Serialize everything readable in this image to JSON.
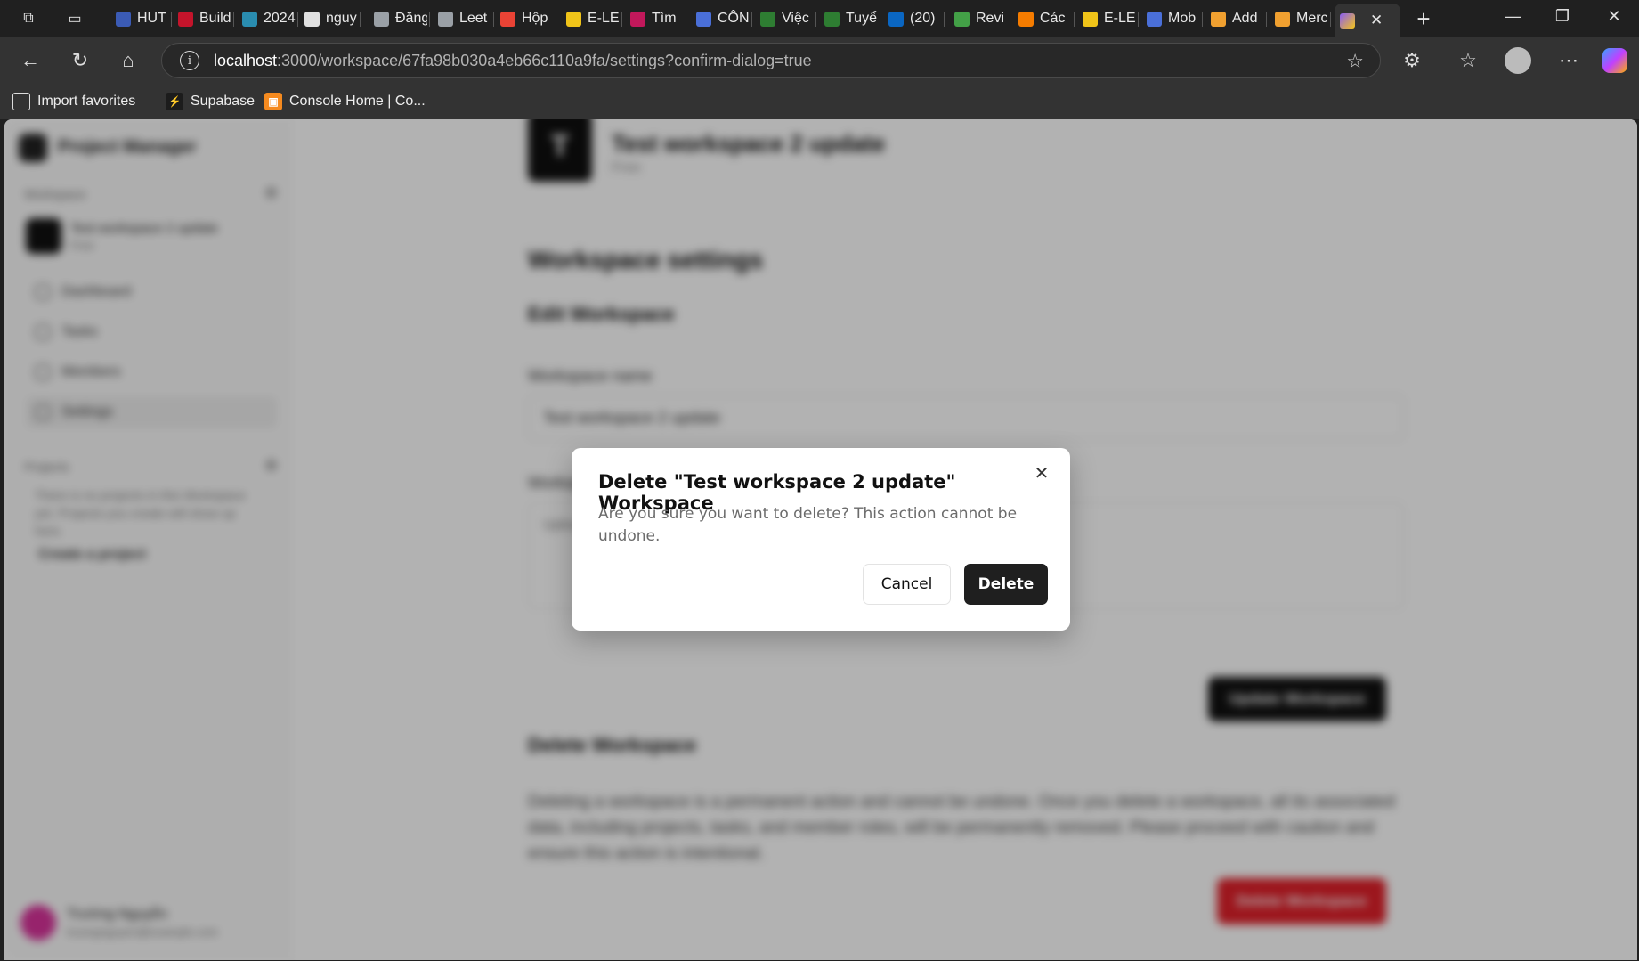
{
  "browser": {
    "tabs": [
      {
        "label": "HUT",
        "color": "#3b5bb5"
      },
      {
        "label": "Build",
        "color": "#c4142b"
      },
      {
        "label": "2024",
        "color": "#2a8db0"
      },
      {
        "label": "nguy",
        "color": "#e0e0e0"
      },
      {
        "label": "Đăng",
        "color": "#9aa0a6"
      },
      {
        "label": "Leet",
        "color": "#9aa0a6"
      },
      {
        "label": "Hộp",
        "color": "#ea4335"
      },
      {
        "label": "E-LE",
        "color": "#f0c419"
      },
      {
        "label": "Tìm",
        "color": "#c2185b"
      },
      {
        "label": "CÔN",
        "color": "#4a6fd8"
      },
      {
        "label": "Việc",
        "color": "#2e7d32"
      },
      {
        "label": "Tuyể",
        "color": "#2e7d32"
      },
      {
        "label": "(20)",
        "color": "#0a66c2"
      },
      {
        "label": "Revi",
        "color": "#43a047"
      },
      {
        "label": "Các",
        "color": "#f57c00"
      },
      {
        "label": "E-LE",
        "color": "#f0c419"
      },
      {
        "label": "Mob",
        "color": "#4a6fd8"
      },
      {
        "label": "Add",
        "color": "#f0a030"
      },
      {
        "label": "Merc",
        "color": "#f0a030"
      }
    ],
    "active_tab_close": "✕",
    "new_tab": "+",
    "url_host": "localhost",
    "url_rest": ":3000/workspace/67fa98b030a4eb66c110a9fa/settings?confirm-dialog=true",
    "favorites": [
      {
        "label": "Import favorites"
      },
      {
        "label": "Supabase"
      },
      {
        "label": "Console Home | Co..."
      }
    ]
  },
  "sidebar": {
    "app_title": "Project Manager",
    "workspaces_label": "Workspace",
    "workspace_name": "Test workspace 2 update",
    "workspace_plan": "Free",
    "nav": [
      "Dashboard",
      "Tasks",
      "Members",
      "Settings"
    ],
    "projects_label": "Projects",
    "projects_note": "There is no projects in this Workspace yet. Projects you create will show up here.",
    "create_project": "Create a project",
    "user_name": "Trường Nguyễn",
    "user_email": "truongnguyen@example.com"
  },
  "main": {
    "workspace_initial": "T",
    "workspace_name": "Test workspace 2 update",
    "workspace_plan": "Free",
    "settings_heading": "Workspace settings",
    "edit_heading": "Edit Workspace",
    "name_label": "Workspace name",
    "name_value": "Test workspace 2 update",
    "image_label": "Workspace Image",
    "image_hint": "Upload",
    "update_button": "Update Workspace",
    "delete_heading": "Delete Workspace",
    "delete_description": "Deleting a workspace is a permanent action and cannot be undone. Once you delete a workspace, all its associated data, including projects, tasks, and member roles, will be permanently removed. Please proceed with caution and ensure this action is intentional.",
    "delete_button": "Delete Workspace"
  },
  "dialog": {
    "title": "Delete \"Test workspace 2 update\" Workspace",
    "description": "Are you sure you want to delete? This action cannot be undone.",
    "cancel_label": "Cancel",
    "confirm_label": "Delete",
    "close_icon": "✕"
  }
}
